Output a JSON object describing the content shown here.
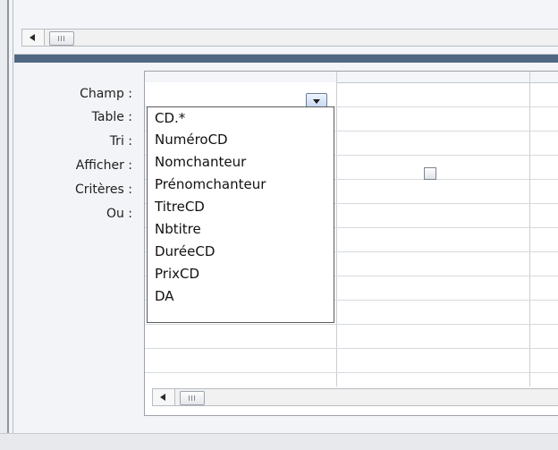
{
  "query_grid": {
    "row_labels": {
      "field": "Champ :",
      "table": "Table :",
      "sort": "Tri :",
      "show": "Afficher :",
      "criteria": "Critères :",
      "or": "Ou :"
    },
    "show_checkbox_checked": false
  },
  "field_dropdown": {
    "options": [
      "CD.*",
      "NuméroCD",
      "Nomchanteur",
      "Prénomchanteur",
      "TitreCD",
      "Nbtitre",
      "DuréeCD",
      "PrixCD",
      "DA"
    ]
  },
  "icons": {
    "scroll_left": "triangle-left-icon",
    "dropdown": "chevron-down-icon",
    "thumb_grip": "grip-lines-icon"
  },
  "colors": {
    "splitter": "#4f6781",
    "grid_border": "#9da3aa",
    "dropdown_border": "#5b5b5b"
  }
}
